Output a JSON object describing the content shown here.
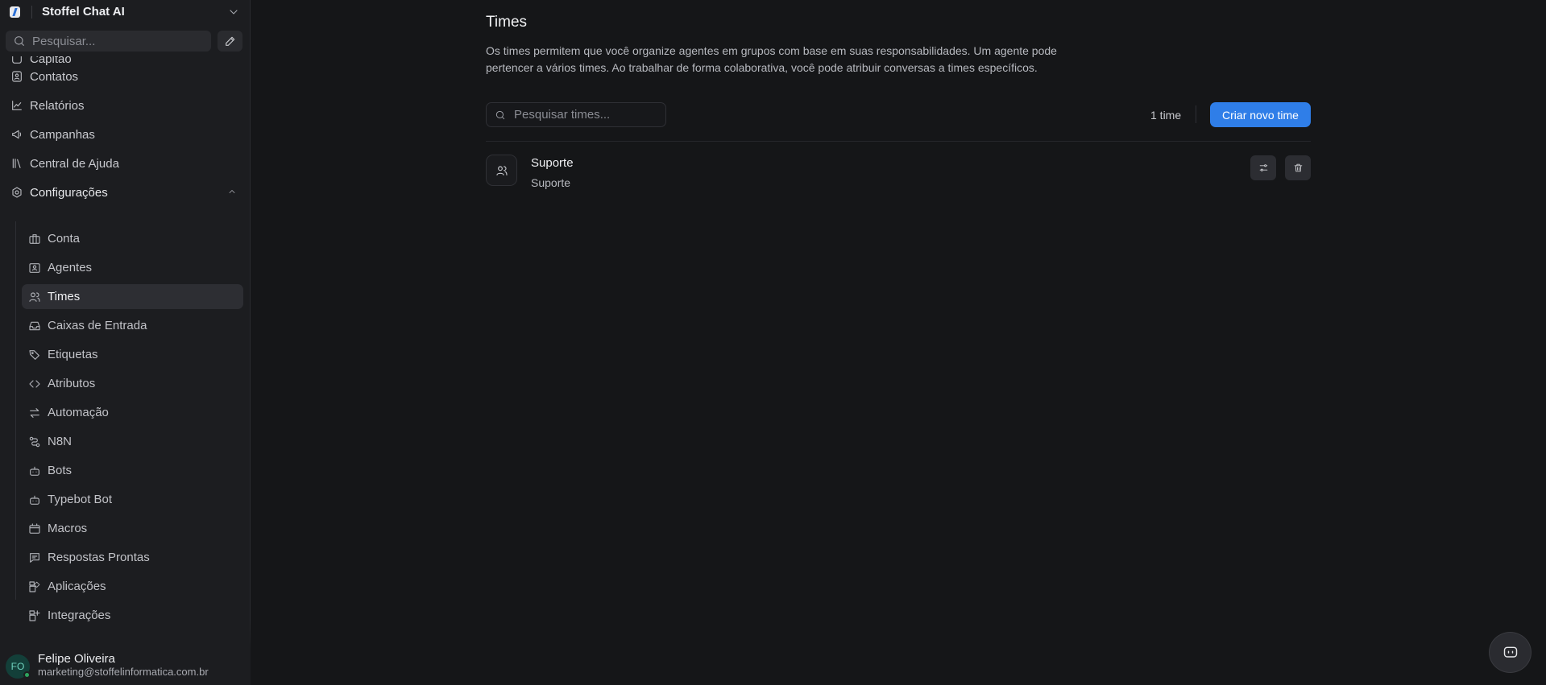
{
  "app": {
    "name": "Stoffel Chat AI"
  },
  "sidebar": {
    "search_placeholder": "Pesquisar...",
    "partial_top_item": "Capitão",
    "items": [
      {
        "label": "Contatos",
        "icon": "contact-card-icon"
      },
      {
        "label": "Relatórios",
        "icon": "chart-line-icon"
      },
      {
        "label": "Campanhas",
        "icon": "megaphone-icon"
      },
      {
        "label": "Central de Ajuda",
        "icon": "library-icon"
      }
    ],
    "settings": {
      "label": "Configurações",
      "expanded": true,
      "items": [
        {
          "label": "Conta",
          "icon": "briefcase-icon"
        },
        {
          "label": "Agentes",
          "icon": "agent-card-icon"
        },
        {
          "label": "Times",
          "icon": "users-icon",
          "active": true
        },
        {
          "label": "Caixas de Entrada",
          "icon": "inbox-icon"
        },
        {
          "label": "Etiquetas",
          "icon": "tags-icon"
        },
        {
          "label": "Atributos",
          "icon": "code-icon"
        },
        {
          "label": "Automação",
          "icon": "arrows-swap-icon"
        },
        {
          "label": "N8N",
          "icon": "workflow-icon"
        },
        {
          "label": "Bots",
          "icon": "bot-icon"
        },
        {
          "label": "Typebot Bot",
          "icon": "bot-icon"
        },
        {
          "label": "Macros",
          "icon": "macro-icon"
        },
        {
          "label": "Respostas Prontas",
          "icon": "message-text-icon"
        },
        {
          "label": "Aplicações",
          "icon": "apps-icon"
        },
        {
          "label": "Integrações",
          "icon": "apps-add-icon"
        }
      ]
    }
  },
  "user": {
    "initials": "FO",
    "name": "Felipe Oliveira",
    "email": "marketing@stoffelinformatica.com.br",
    "status": "online"
  },
  "page": {
    "title": "Times",
    "description": "Os times permitem que você organize agentes em grupos com base em suas responsabilidades. Um agente pode pertencer a vários times. Ao trabalhar de forma colaborativa, você pode atribuir conversas a times específicos.",
    "search_placeholder": "Pesquisar times...",
    "count_label": "1 time",
    "create_button": "Criar novo time",
    "teams": [
      {
        "name": "Suporte",
        "description": "Suporte"
      }
    ]
  },
  "colors": {
    "accent": "#2f7ee8",
    "background": "#151618",
    "sidebar": "#1c1d20"
  }
}
